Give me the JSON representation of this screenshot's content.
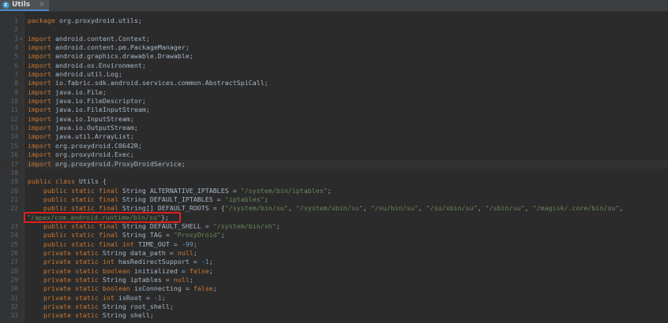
{
  "tab": {
    "icon": "class-c-icon",
    "icon_letter": "c",
    "label": "Utils",
    "close": "×"
  },
  "highlight_color": "#e0201c",
  "lines": [
    {
      "n": "1",
      "t": [
        [
          "kw",
          "package"
        ],
        [
          "p",
          " org.proxydroid.utils;"
        ]
      ]
    },
    {
      "n": "2",
      "t": []
    },
    {
      "n": "3",
      "t": [
        [
          "kw",
          "import"
        ],
        [
          "p",
          " android.content.Context;"
        ]
      ],
      "fold": true
    },
    {
      "n": "4",
      "t": [
        [
          "kw",
          "import"
        ],
        [
          "p",
          " android.content.pm.PackageManager;"
        ]
      ]
    },
    {
      "n": "5",
      "t": [
        [
          "kw",
          "import"
        ],
        [
          "p",
          " android.graphics.drawable.Drawable;"
        ]
      ]
    },
    {
      "n": "6",
      "t": [
        [
          "kw",
          "import"
        ],
        [
          "p",
          " android.os.Environment;"
        ]
      ]
    },
    {
      "n": "7",
      "t": [
        [
          "kw",
          "import"
        ],
        [
          "p",
          " android.util.Log;"
        ]
      ]
    },
    {
      "n": "8",
      "t": [
        [
          "kw",
          "import"
        ],
        [
          "p",
          " io.fabric.sdk.android.services.common.AbstractSpiCall;"
        ]
      ]
    },
    {
      "n": "9",
      "t": [
        [
          "kw",
          "import"
        ],
        [
          "p",
          " java.io.File;"
        ]
      ]
    },
    {
      "n": "10",
      "t": [
        [
          "kw",
          "import"
        ],
        [
          "p",
          " java.io.FileDescriptor;"
        ]
      ]
    },
    {
      "n": "11",
      "t": [
        [
          "kw",
          "import"
        ],
        [
          "p",
          " java.io.FileInputStream;"
        ]
      ]
    },
    {
      "n": "12",
      "t": [
        [
          "kw",
          "import"
        ],
        [
          "p",
          " java.io.InputStream;"
        ]
      ]
    },
    {
      "n": "13",
      "t": [
        [
          "kw",
          "import"
        ],
        [
          "p",
          " java.io.OutputStream;"
        ]
      ]
    },
    {
      "n": "14",
      "t": [
        [
          "kw",
          "import"
        ],
        [
          "p",
          " java.util.ArrayList;"
        ]
      ]
    },
    {
      "n": "15",
      "t": [
        [
          "kw",
          "import"
        ],
        [
          "p",
          " org.proxydroid.C0642R;"
        ]
      ]
    },
    {
      "n": "16",
      "t": [
        [
          "kw",
          "import"
        ],
        [
          "p",
          " org.proxydroid.Exec;"
        ]
      ]
    },
    {
      "n": "17",
      "t": [
        [
          "kw",
          "import"
        ],
        [
          "p",
          " org.proxydroid.ProxyDroidService;"
        ]
      ],
      "current": true
    },
    {
      "n": "18",
      "t": []
    },
    {
      "n": "19",
      "t": [
        [
          "kw",
          "public class"
        ],
        [
          "p",
          " Utils {"
        ]
      ]
    },
    {
      "n": "20",
      "t": [
        [
          "p",
          "    "
        ],
        [
          "kw",
          "public static final"
        ],
        [
          "p",
          " String ALTERNATIVE_IPTABLES = "
        ],
        [
          "str",
          "\"/system/bin/iptables\""
        ],
        [
          "p",
          ";"
        ]
      ]
    },
    {
      "n": "21",
      "t": [
        [
          "p",
          "    "
        ],
        [
          "kw",
          "public static final"
        ],
        [
          "p",
          " String DEFAULT_IPTABLES = "
        ],
        [
          "str",
          "\"iptables\""
        ],
        [
          "p",
          ";"
        ]
      ]
    },
    {
      "n": "22",
      "t": [
        [
          "p",
          "    "
        ],
        [
          "kw",
          "public static final"
        ],
        [
          "p",
          " String[] DEFAULT_ROOTS = {"
        ],
        [
          "str",
          "\"/system/bin/su\""
        ],
        [
          "p",
          ", "
        ],
        [
          "str",
          "\"/system/xbin/su\""
        ],
        [
          "p",
          ", "
        ],
        [
          "str",
          "\"/su/bin/su\""
        ],
        [
          "p",
          ", "
        ],
        [
          "str",
          "\"/su/xbin/su\""
        ],
        [
          "p",
          ", "
        ],
        [
          "str",
          "\"/sbin/su\""
        ],
        [
          "p",
          ", "
        ],
        [
          "str",
          "\"/magisk/.core/bin/su\""
        ],
        [
          "p",
          ","
        ]
      ]
    },
    {
      "n": "",
      "t": [
        [
          "str",
          "\"/apex/com.android.runtime/bin/su\""
        ],
        [
          "p",
          "};"
        ]
      ],
      "wrap": true
    },
    {
      "n": "23",
      "t": [
        [
          "p",
          "    "
        ],
        [
          "kw",
          "public static final"
        ],
        [
          "p",
          " String DEFAULT_SHELL = "
        ],
        [
          "str",
          "\"/system/bin/sh\""
        ],
        [
          "p",
          ";"
        ]
      ]
    },
    {
      "n": "24",
      "t": [
        [
          "p",
          "    "
        ],
        [
          "kw",
          "public static final"
        ],
        [
          "p",
          " String TAG = "
        ],
        [
          "str",
          "\"ProxyDroid\""
        ],
        [
          "p",
          ";"
        ]
      ]
    },
    {
      "n": "25",
      "t": [
        [
          "p",
          "    "
        ],
        [
          "kw",
          "public static final int"
        ],
        [
          "p",
          " TIME_OUT = "
        ],
        [
          "num",
          "-99"
        ],
        [
          "p",
          ";"
        ]
      ]
    },
    {
      "n": "26",
      "t": [
        [
          "p",
          "    "
        ],
        [
          "kw",
          "private static"
        ],
        [
          "p",
          " String data_path = "
        ],
        [
          "kw",
          "null"
        ],
        [
          "p",
          ";"
        ]
      ]
    },
    {
      "n": "27",
      "t": [
        [
          "p",
          "    "
        ],
        [
          "kw",
          "private static int"
        ],
        [
          "p",
          " hasRedirectSupport = "
        ],
        [
          "num",
          "-1"
        ],
        [
          "p",
          ";"
        ]
      ]
    },
    {
      "n": "28",
      "t": [
        [
          "p",
          "    "
        ],
        [
          "kw",
          "private static boolean"
        ],
        [
          "p",
          " initialized = "
        ],
        [
          "kw",
          "false"
        ],
        [
          "p",
          ";"
        ]
      ]
    },
    {
      "n": "29",
      "t": [
        [
          "p",
          "    "
        ],
        [
          "kw",
          "private static"
        ],
        [
          "p",
          " String iptables = "
        ],
        [
          "kw",
          "null"
        ],
        [
          "p",
          ";"
        ]
      ]
    },
    {
      "n": "30",
      "t": [
        [
          "p",
          "    "
        ],
        [
          "kw",
          "private static boolean"
        ],
        [
          "p",
          " isConnecting = "
        ],
        [
          "kw",
          "false"
        ],
        [
          "p",
          ";"
        ]
      ]
    },
    {
      "n": "31",
      "t": [
        [
          "p",
          "    "
        ],
        [
          "kw",
          "private static int"
        ],
        [
          "p",
          " isRoot = "
        ],
        [
          "num",
          "-1"
        ],
        [
          "p",
          ";"
        ]
      ]
    },
    {
      "n": "32",
      "t": [
        [
          "p",
          "    "
        ],
        [
          "kw",
          "private static"
        ],
        [
          "p",
          " String root_shell;"
        ]
      ]
    },
    {
      "n": "33",
      "t": [
        [
          "p",
          "    "
        ],
        [
          "kw",
          "private static"
        ],
        [
          "p",
          " String shell;"
        ]
      ]
    }
  ]
}
